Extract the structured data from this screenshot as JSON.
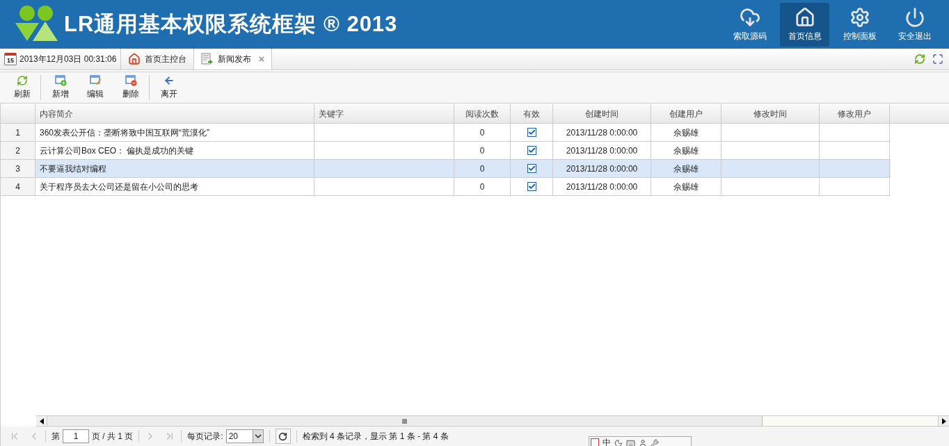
{
  "header": {
    "title": "LR通用基本权限系统框架 ® 2013",
    "nav": [
      {
        "label": "索取源码",
        "kind": "download",
        "selected": false
      },
      {
        "label": "首页信息",
        "kind": "home",
        "selected": true
      },
      {
        "label": "控制面板",
        "kind": "settings",
        "selected": false
      },
      {
        "label": "安全退出",
        "kind": "power",
        "selected": false
      }
    ]
  },
  "tabbar": {
    "date_icon": "15",
    "datetime": "2013年12月03日 00:31:06",
    "tabs": [
      {
        "label": "首页主控台",
        "kind": "home",
        "selected": false,
        "closable": false
      },
      {
        "label": "新闻发布",
        "kind": "news",
        "selected": true,
        "closable": true
      }
    ],
    "close_mark": "×"
  },
  "toolbar": [
    {
      "label": "刷新",
      "kind": "refresh",
      "separator_after": true
    },
    {
      "label": "新增",
      "kind": "add",
      "separator_after": false
    },
    {
      "label": "编辑",
      "kind": "edit",
      "separator_after": false
    },
    {
      "label": "删除",
      "kind": "delete",
      "separator_after": true
    },
    {
      "label": "离开",
      "kind": "back",
      "separator_after": false
    }
  ],
  "table": {
    "columns": [
      "内容简介",
      "关键字",
      "阅读次数",
      "有效",
      "创建时间",
      "创建用户",
      "修改时间",
      "修改用户"
    ],
    "rows": [
      {
        "num": "1",
        "summary": "360发表公开信：垄断将致中国互联网“荒漠化”",
        "reads": "0",
        "valid": true,
        "created": "2013/11/28 0:00:00",
        "creator": "佘赐雄",
        "selected": false
      },
      {
        "num": "2",
        "summary": "云计算公司Box CEO： 偏执是成功的关键",
        "reads": "0",
        "valid": true,
        "created": "2013/11/28 0:00:00",
        "creator": "佘赐雄",
        "selected": false
      },
      {
        "num": "3",
        "summary": "不要逼我结对编程",
        "reads": "0",
        "valid": true,
        "created": "2013/11/28 0:00:00",
        "creator": "佘赐雄",
        "selected": true
      },
      {
        "num": "4",
        "summary": "关于程序员去大公司还是留在小公司的思考",
        "reads": "0",
        "valid": true,
        "created": "2013/11/28 0:00:00",
        "creator": "佘赐雄",
        "selected": false
      }
    ]
  },
  "pager": {
    "page_prefix": "第",
    "page": "1",
    "page_suffix": "页 / 共 1 页",
    "per_page_label": "每页记录:",
    "per_page": "20",
    "summary": "检索到 4 条记录，显示 第 1 条 - 第 4 条"
  },
  "ime": {
    "mode": "中"
  }
}
